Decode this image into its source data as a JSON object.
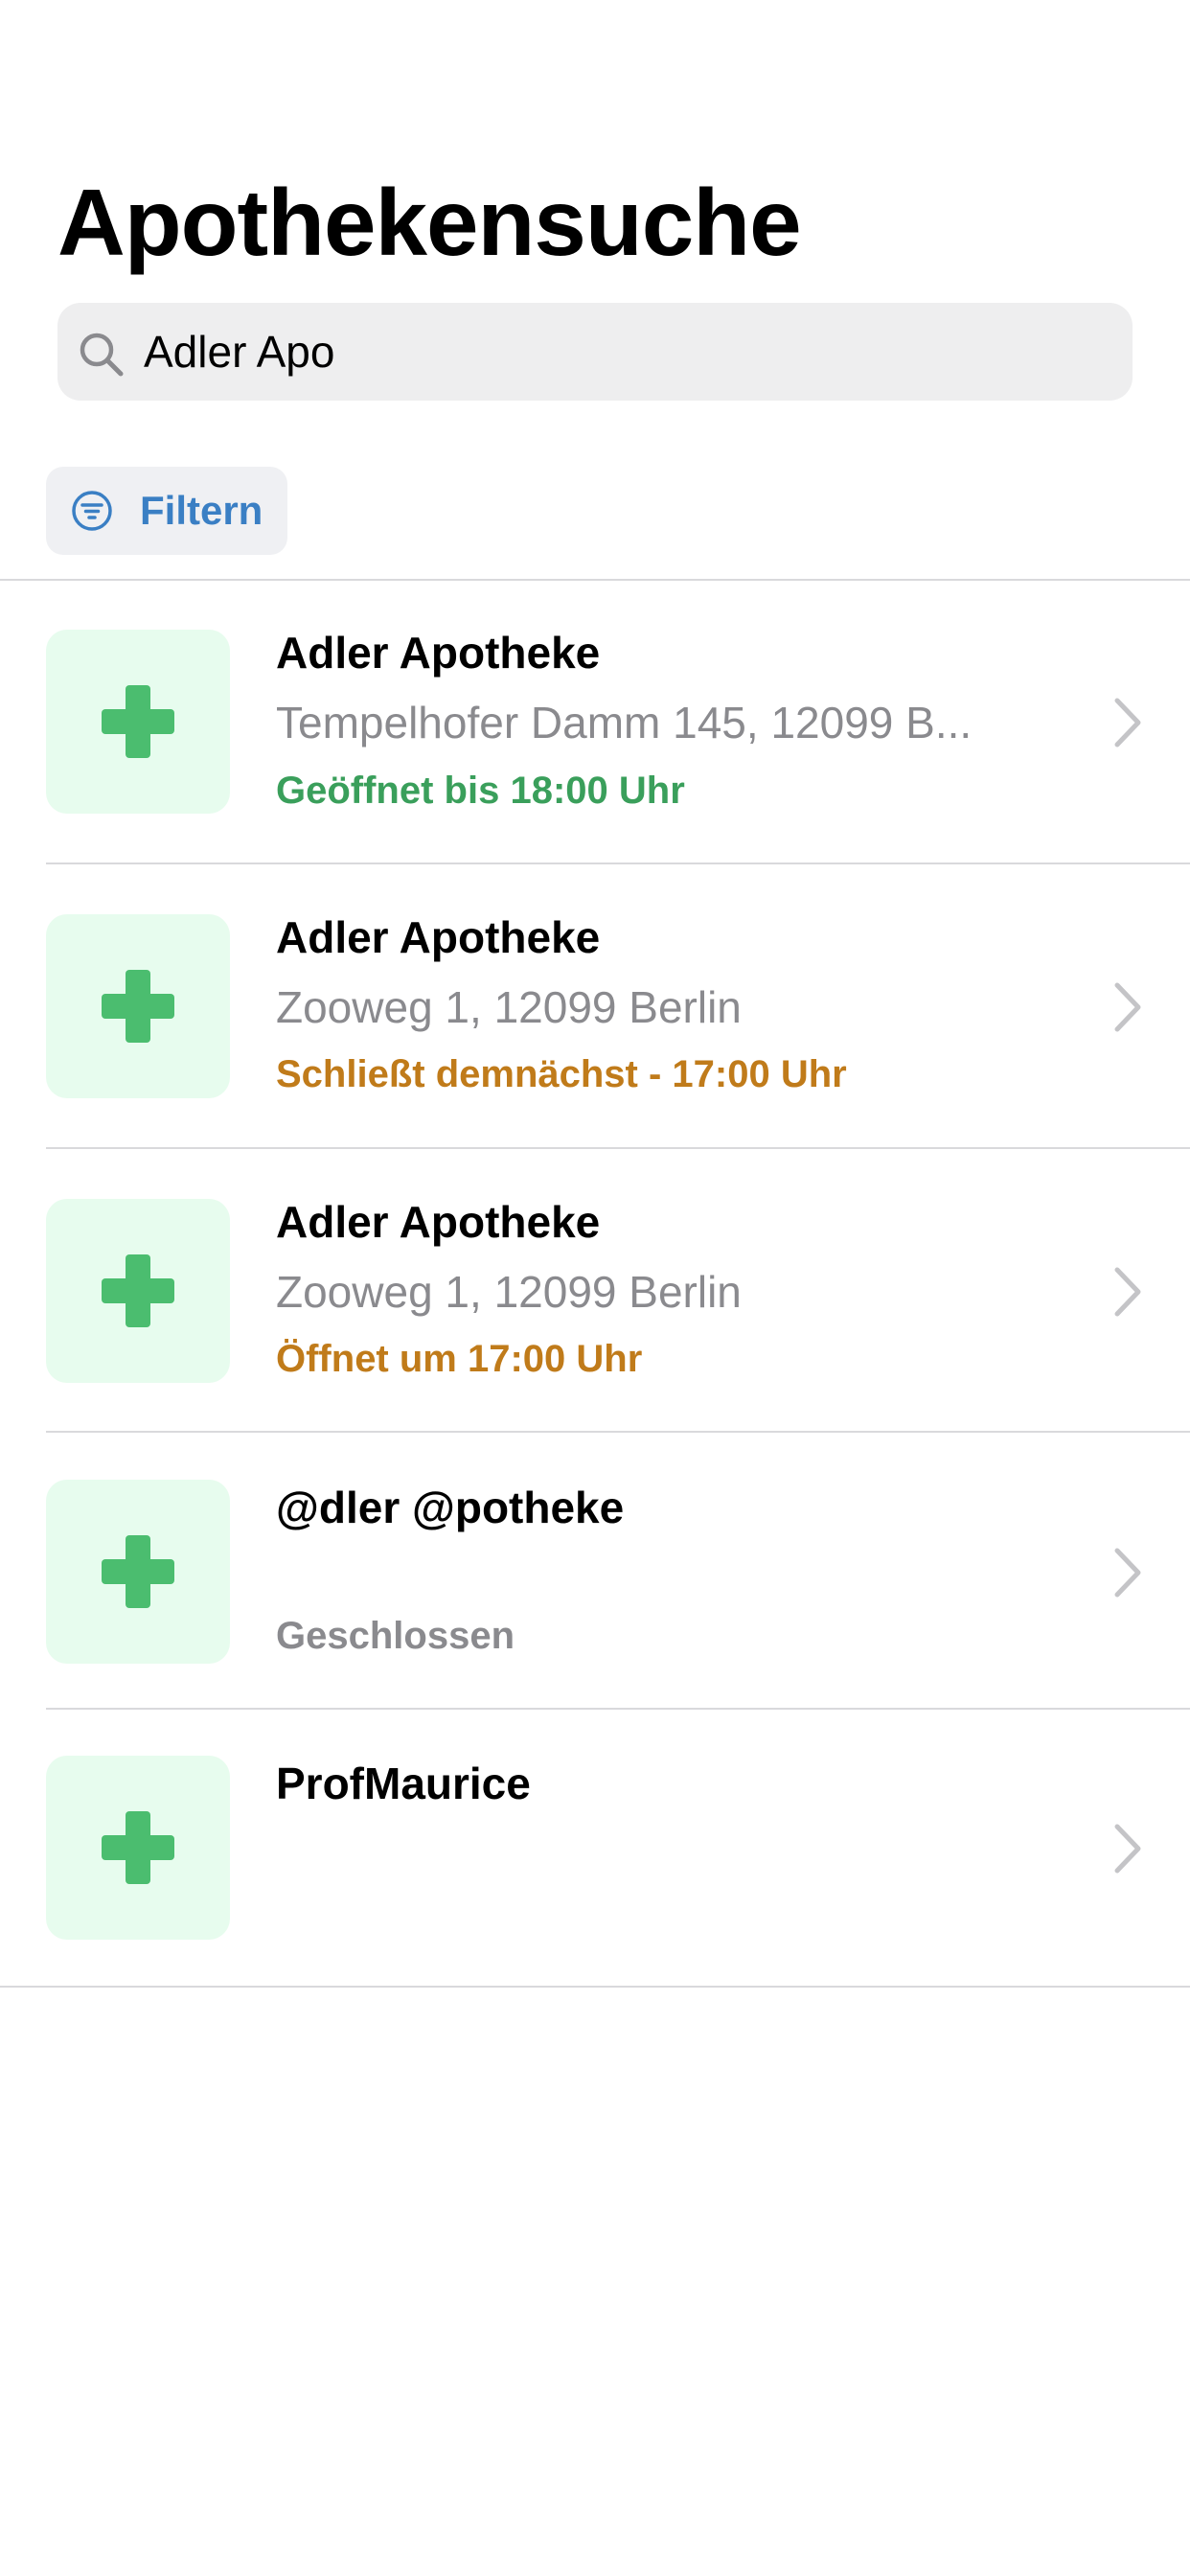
{
  "header": {
    "title": "Apothekensuche"
  },
  "search": {
    "value": "Adler Apo",
    "icon": "search-icon"
  },
  "filter": {
    "label": "Filtern",
    "icon": "filter-icon"
  },
  "colors": {
    "open": "#3a9f5b",
    "warning": "#c07b1a",
    "closed": "#8a8a8e",
    "accent": "#3a7fc4",
    "cross": "#4bbd6f",
    "thumb_bg": "#e7fcee"
  },
  "pharmacies": [
    {
      "name": "Adler Apotheke",
      "address": "Tempelhofer Damm 145, 12099 B...",
      "status": "Geöffnet bis 18:00 Uhr",
      "status_type": "open",
      "icon": "pharmacy-cross-icon"
    },
    {
      "name": "Adler Apotheke",
      "address": "Zooweg 1, 12099 Berlin",
      "status": "Schließt demnächst - 17:00 Uhr",
      "status_type": "warning",
      "icon": "pharmacy-cross-icon"
    },
    {
      "name": "Adler Apotheke",
      "address": "Zooweg 1, 12099 Berlin",
      "status": "Öffnet um 17:00 Uhr",
      "status_type": "warning",
      "icon": "pharmacy-cross-icon"
    },
    {
      "name": "@dler @potheke",
      "address": "",
      "status": "Geschlossen",
      "status_type": "closed",
      "icon": "pharmacy-cross-icon"
    },
    {
      "name": "ProfMaurice",
      "address": "",
      "status": "",
      "status_type": "none",
      "icon": "pharmacy-cross-icon"
    }
  ]
}
